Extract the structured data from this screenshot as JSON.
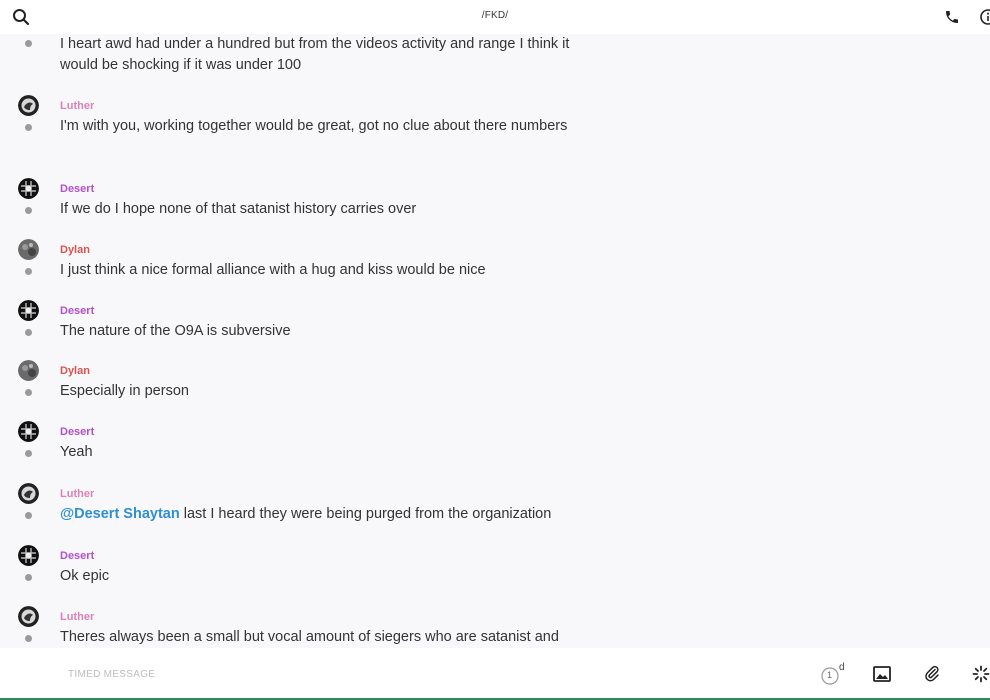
{
  "header": {
    "title": "/FKD/",
    "icons": [
      "search-icon",
      "phone-icon",
      "info-icon"
    ]
  },
  "messages": [
    {
      "sender": "",
      "color": "",
      "parts": [
        "I heart awd had under a hundred but from the videos activity and range I think it would be shocking if it was under 100"
      ]
    },
    {
      "sender": "Luther",
      "color": "#d982b7",
      "parts": [
        "I'm with you, working together would be great, got no clue about there numbers"
      ]
    },
    {
      "sender": "Desert",
      "color": "#b44fd0",
      "parts": [
        "If we do I hope none of that satanist history carries over"
      ]
    },
    {
      "sender": "Dylan",
      "color": "#d9534f",
      "parts": [
        "I just think a nice formal alliance with a hug and kiss would be nice"
      ]
    },
    {
      "sender": "Desert",
      "color": "#b44fd0",
      "parts": [
        "The nature of the O9A is subversive"
      ]
    },
    {
      "sender": "Dylan",
      "color": "#d9534f",
      "parts": [
        "Especially in person"
      ]
    },
    {
      "sender": "Desert",
      "color": "#b44fd0",
      "parts": [
        "Yeah"
      ]
    },
    {
      "sender": "Luther",
      "color": "#d982b7",
      "mention": "@Desert Shaytan",
      "parts": [
        " last I heard they were being purged from the organization"
      ]
    },
    {
      "sender": "Desert",
      "color": "#b44fd0",
      "parts": [
        "Ok epic"
      ]
    },
    {
      "sender": "Luther",
      "color": "#d982b7",
      "parts": [
        "Theres always been a small but vocal amount of siegers who are satanist and"
      ]
    }
  ],
  "composer": {
    "placeholder": "TIMED MESSAGE",
    "timer_count": "1",
    "timer_unit": "d",
    "icons": [
      "timer-icon",
      "image-icon",
      "paperclip-icon",
      "sparkle-icon"
    ]
  }
}
